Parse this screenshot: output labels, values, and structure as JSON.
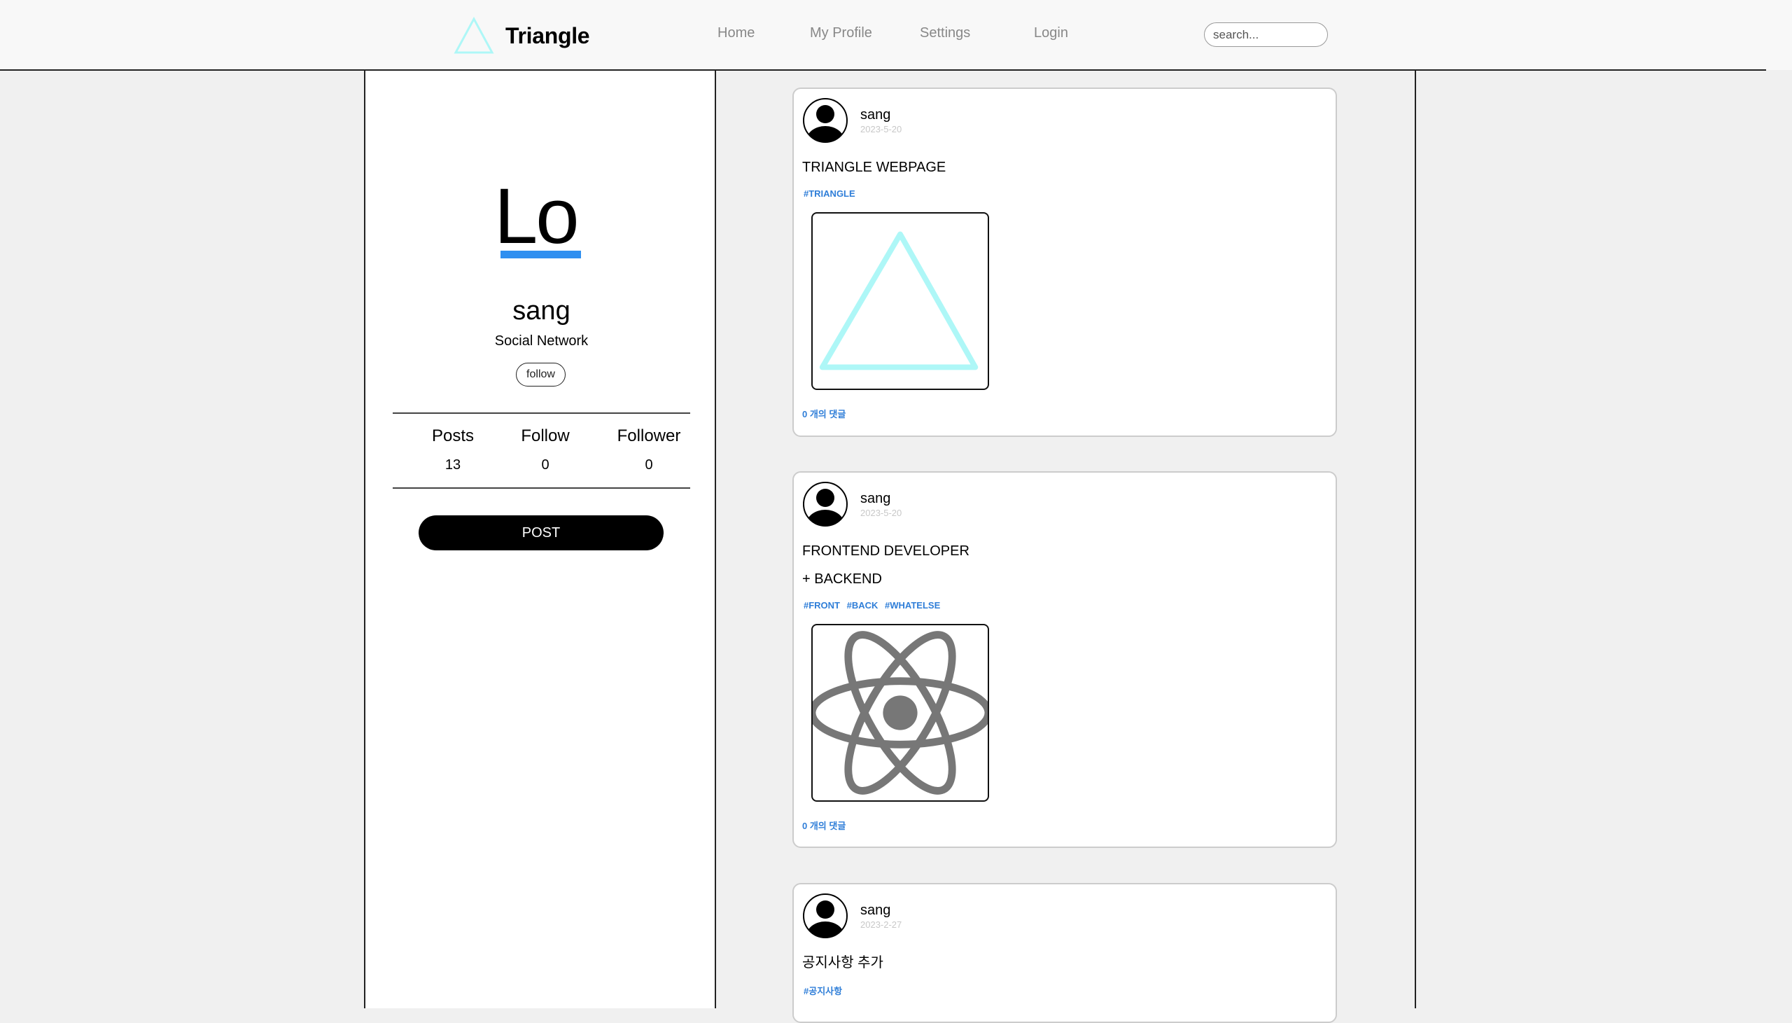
{
  "brand": {
    "name": "Triangle",
    "logo_icon": "triangle-logo-icon"
  },
  "nav": {
    "home": "Home",
    "profile": "My Profile",
    "settings": "Settings",
    "login": "Login"
  },
  "search": {
    "placeholder": "search..."
  },
  "profile": {
    "logo_text": "Lo",
    "accent_color": "#2f8ff0",
    "name": "sang",
    "tagline": "Social Network",
    "follow_label": "follow",
    "stats": {
      "posts_label": "Posts",
      "posts_value": "13",
      "follow_label": "Follow",
      "follow_value": "0",
      "follower_label": "Follower",
      "follower_value": "0"
    },
    "post_button": "POST"
  },
  "posts": [
    {
      "author": "sang",
      "date": "2023-5-20",
      "lines": [
        "TRIANGLE WEBPAGE"
      ],
      "tags": [
        "#TRIANGLE"
      ],
      "image_icon": "triangle-image-icon",
      "comments": "0 개의 댓글"
    },
    {
      "author": "sang",
      "date": "2023-5-20",
      "lines": [
        "FRONTEND DEVELOPER",
        "+ BACKEND"
      ],
      "tags": [
        "#FRONT",
        "#BACK",
        "#WHATELSE"
      ],
      "image_icon": "react-atom-icon",
      "comments": "0 개의 댓글"
    },
    {
      "author": "sang",
      "date": "2023-2-27",
      "lines": [
        "공지사항 추가"
      ],
      "tags": [
        "#공지사항"
      ]
    }
  ],
  "colors": {
    "triangle_cyan": "#aef7f7",
    "link_blue": "#2f7ed8",
    "react_gray": "#777777"
  }
}
